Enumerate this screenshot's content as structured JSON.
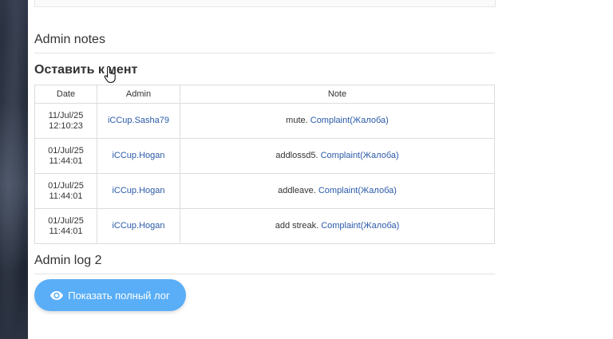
{
  "admin_notes": {
    "title": "Admin notes"
  },
  "comment": {
    "title": "Оставить к мент"
  },
  "table": {
    "headers": [
      "Date",
      "Admin",
      "Note"
    ],
    "rows": [
      {
        "date_line1": "11/Jul/25",
        "date_line2": "12:10:23",
        "admin": "iCCup.Sasha79",
        "note_prefix": "mute. ",
        "note_link": "Complaint(Жалоба)"
      },
      {
        "date_line1": "01/Jul/25",
        "date_line2": "11:44:01",
        "admin": "iCCup.Hogan",
        "note_prefix": "addlossd5. ",
        "note_link": "Complaint(Жалоба)"
      },
      {
        "date_line1": "01/Jul/25",
        "date_line2": "11:44:01",
        "admin": "iCCup.Hogan",
        "note_prefix": "addleave. ",
        "note_link": "Complaint(Жалоба)"
      },
      {
        "date_line1": "01/Jul/25",
        "date_line2": "11:44:01",
        "admin": "iCCup.Hogan",
        "note_prefix": "add streak. ",
        "note_link": "Complaint(Жалоба)"
      }
    ]
  },
  "admin_log": {
    "title": "Admin log 2",
    "button_label": "Показать полный лог",
    "button_icon": "eye-icon"
  },
  "colors": {
    "accent": "#5aaef7",
    "link": "#2a5aa8"
  }
}
